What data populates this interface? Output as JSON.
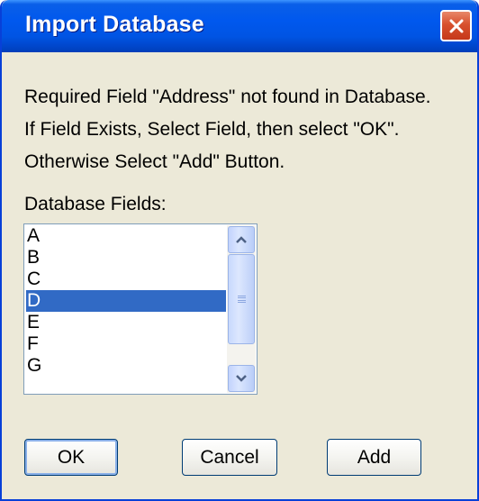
{
  "dialog": {
    "title": "Import Database",
    "message_lines": [
      "Required Field \"Address\" not found in Database.",
      "If Field Exists, Select Field, then select \"OK\".",
      "Otherwise Select \"Add\" Button."
    ],
    "list_label": "Database Fields:",
    "fields": [
      "A",
      "B",
      "C",
      "D",
      "E",
      "F",
      "G"
    ],
    "selected_field": "D",
    "buttons": {
      "ok": "OK",
      "cancel": "Cancel",
      "add": "Add"
    }
  },
  "icons": {
    "close": "close-icon",
    "scroll_up": "chevron-up-icon",
    "scroll_down": "chevron-down-icon"
  },
  "colors": {
    "titlebar": "#0054e3",
    "selection": "#316ac5",
    "dialog_background": "#ece9d8",
    "close_button": "#d8512e"
  }
}
